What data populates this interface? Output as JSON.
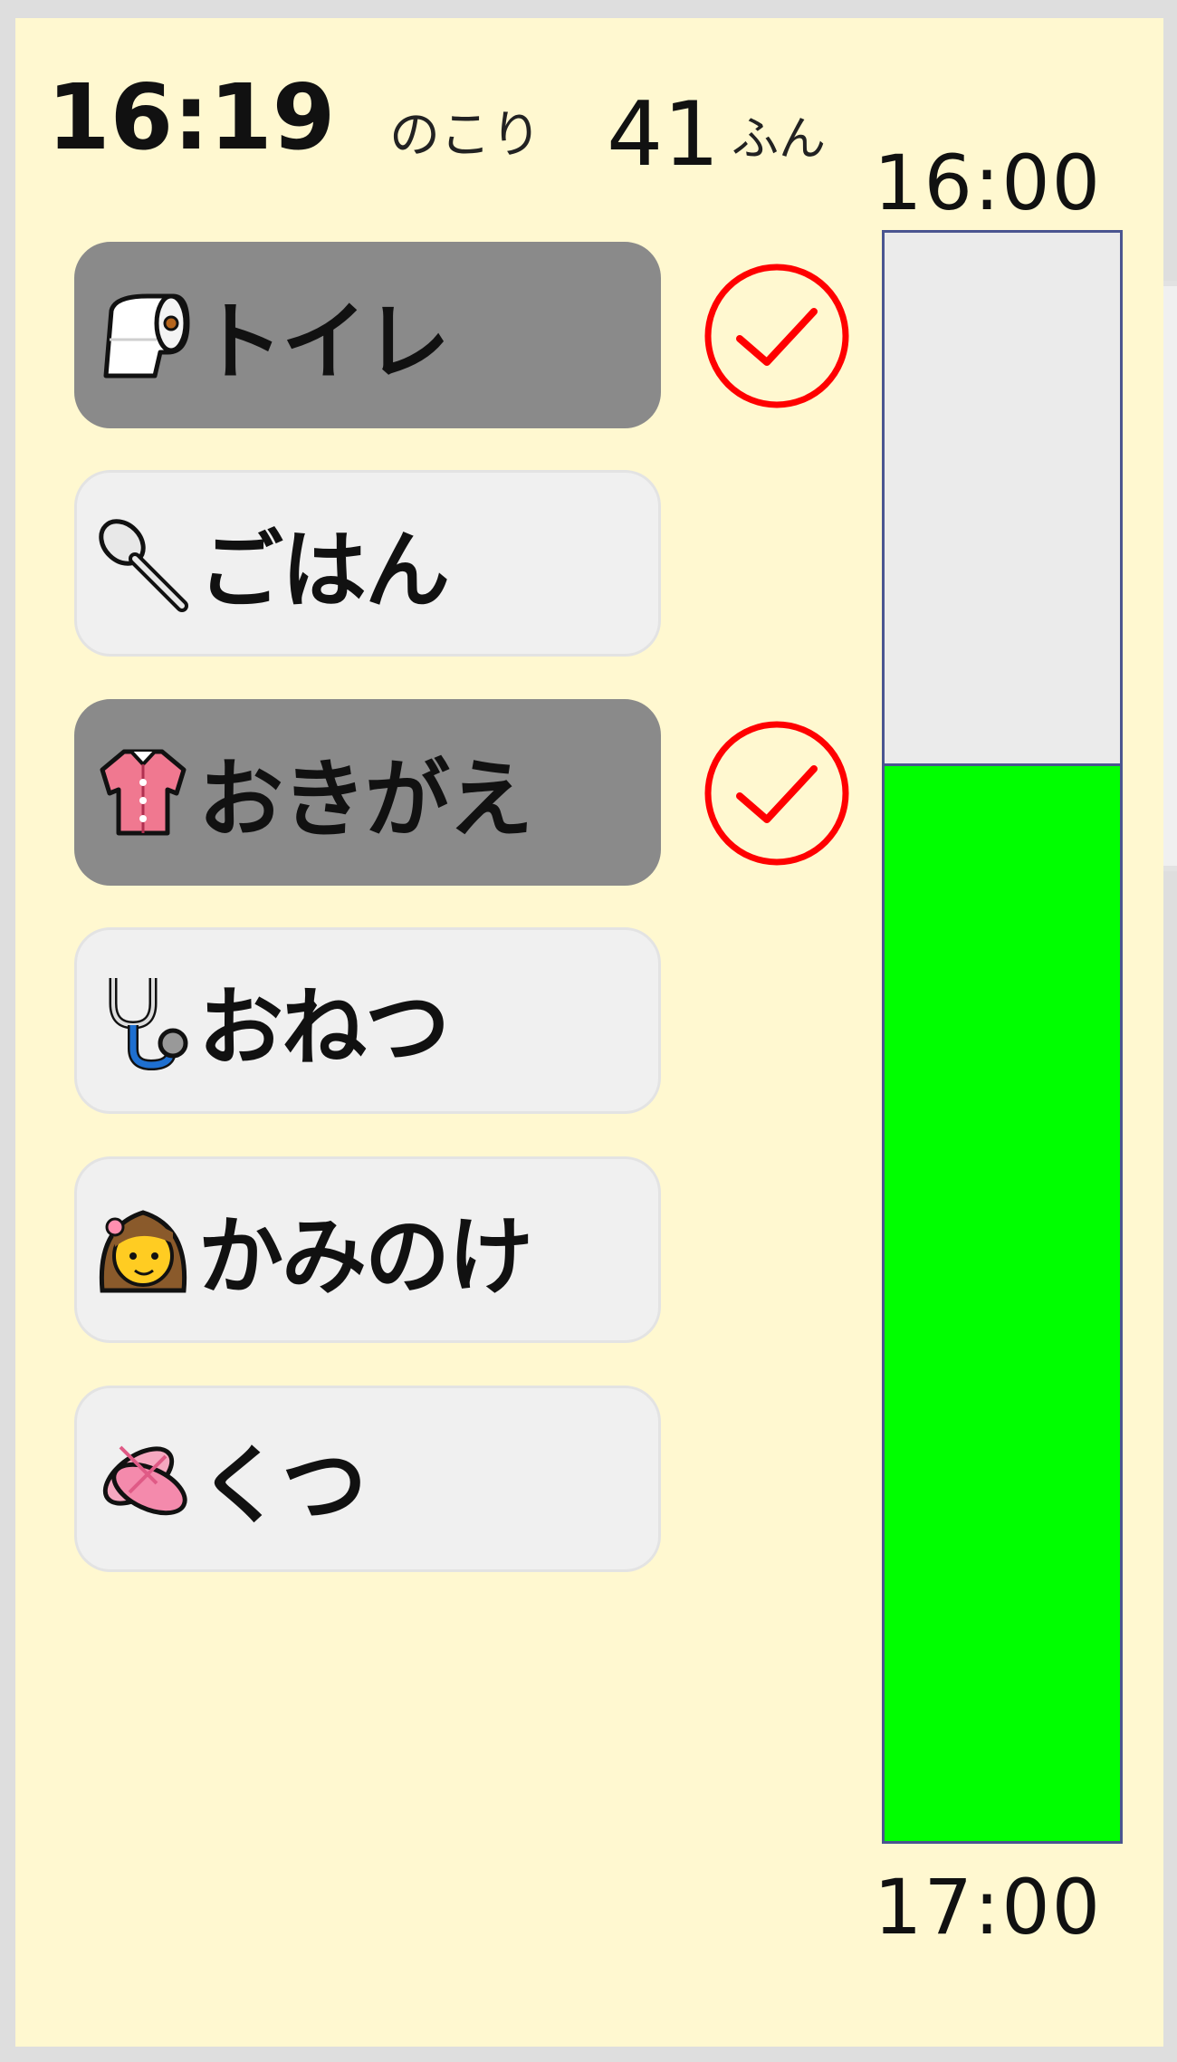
{
  "header": {
    "current_time": "16:19",
    "remaining_label": "のこり",
    "remaining_value": "41",
    "remaining_unit": "ふん"
  },
  "tasks": [
    {
      "label": "トイレ",
      "icon": "toilet-paper-icon",
      "done": true
    },
    {
      "label": "ごはん",
      "icon": "spoon-icon",
      "done": false
    },
    {
      "label": "おきがえ",
      "icon": "shirt-icon",
      "done": true
    },
    {
      "label": "おねつ",
      "icon": "stethoscope-icon",
      "done": false
    },
    {
      "label": "かみのけ",
      "icon": "girl-hair-icon",
      "done": false
    },
    {
      "label": "くつ",
      "icon": "ballet-shoes-icon",
      "done": false
    }
  ],
  "timeline": {
    "start_label": "16:00",
    "end_label": "17:00",
    "remaining_fraction": 0.67,
    "fill_color": "#00ff00",
    "empty_color": "#ebebeb"
  },
  "colors": {
    "background": "#fff8d0",
    "done_button": "#8a8a8a",
    "todo_button": "#f0f0f0",
    "check": "#ff0000"
  }
}
